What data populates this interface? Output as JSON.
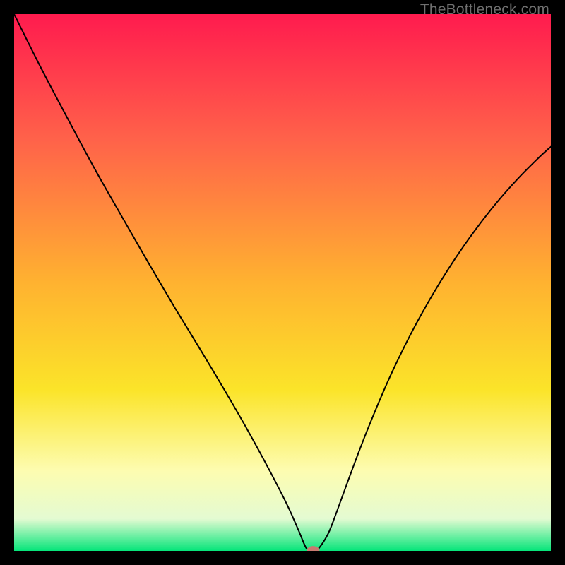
{
  "watermark": "TheBottleneck.com",
  "chart_data": {
    "type": "line",
    "title": "",
    "xlabel": "",
    "ylabel": "",
    "xlim": [
      0,
      100
    ],
    "ylim": [
      0,
      100
    ],
    "grid": false,
    "legend": false,
    "background_gradient": {
      "stops": [
        {
          "offset": 0.0,
          "color": "#ff1b4e"
        },
        {
          "offset": 0.23,
          "color": "#ff614a"
        },
        {
          "offset": 0.5,
          "color": "#ffb230"
        },
        {
          "offset": 0.7,
          "color": "#fbe429"
        },
        {
          "offset": 0.85,
          "color": "#fdfcb0"
        },
        {
          "offset": 0.94,
          "color": "#e4fbd2"
        },
        {
          "offset": 1.0,
          "color": "#06e57a"
        }
      ]
    },
    "series": [
      {
        "name": "curve",
        "color": "#000000",
        "x": [
          0,
          5,
          10,
          15,
          20,
          25,
          30,
          35,
          40,
          44,
          48,
          51,
          53,
          54.5,
          55.7,
          56.7,
          58.5,
          60,
          63,
          66,
          70,
          74,
          78,
          82,
          86,
          90,
          94,
          98,
          100
        ],
        "y": [
          100,
          90,
          80.5,
          71.2,
          62.4,
          53.7,
          45.2,
          37,
          28.6,
          21.6,
          14.2,
          8.3,
          3.8,
          0.4,
          0.1,
          0.4,
          3.2,
          7.0,
          15.2,
          23.0,
          32.4,
          40.6,
          47.8,
          54.2,
          59.9,
          65.0,
          69.5,
          73.5,
          75.3
        ]
      }
    ],
    "marker": {
      "x": 55.7,
      "y": 0.0,
      "rx": 1.2,
      "ry": 0.9,
      "color": "#c97a70"
    }
  }
}
